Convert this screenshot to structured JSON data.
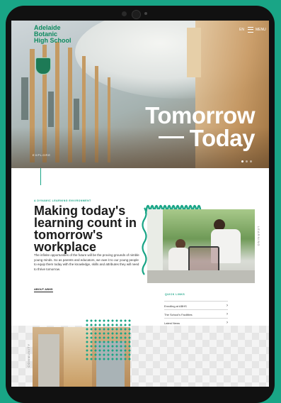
{
  "site": {
    "logo_text": "Adelaide\nBotanic\nHigh School",
    "lang": "EN",
    "menu_label": "MENU"
  },
  "hero": {
    "title_line1": "Tomorrow",
    "title_line2": "Today",
    "explore": "EXPLORE",
    "slides": 3
  },
  "intro": {
    "eyebrow": "A DYNAMIC LEARNING ENVIRONMENT",
    "heading": "Making today's learning count in tomorrow's workplace",
    "body": "The infinite opportunities of the future will be the proving grounds of nimble young minds. So as parents and educators, we owe it to our young people to equip them today with the knowledge, skills and attributes they will need to thrive tomorrow.",
    "about_link": "ABOUT ABHS",
    "side_label": "LEARNING"
  },
  "quick_links": {
    "title": "QUICK LINKS",
    "items": [
      {
        "label": "Enrolling at ABHS"
      },
      {
        "label": "The School's Facilities"
      },
      {
        "label": "Latest News"
      }
    ]
  },
  "bottom": {
    "side_label": "COMMUNITY"
  },
  "colors": {
    "accent": "#19a586",
    "background": "#19a586",
    "tablet": "#111111"
  }
}
